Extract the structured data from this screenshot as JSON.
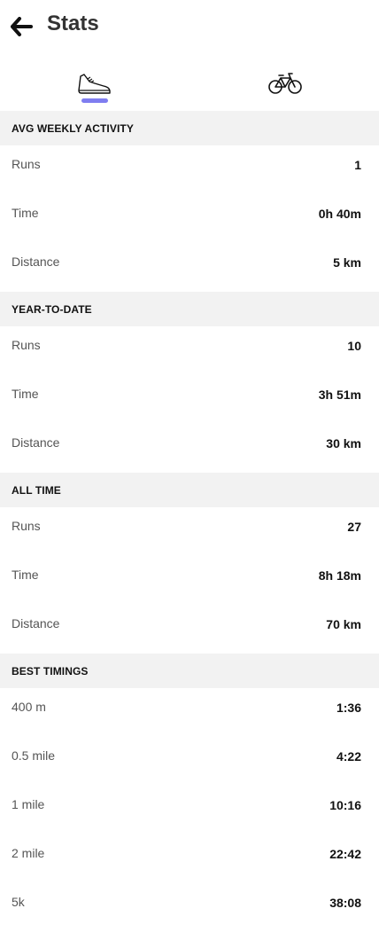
{
  "header": {
    "title": "Stats"
  },
  "tabs": [
    {
      "icon": "running-shoe-icon",
      "selected": true
    },
    {
      "icon": "bicycle-icon",
      "selected": false
    }
  ],
  "accent_color": "#7f7df0",
  "sections": [
    {
      "title": "AVG WEEKLY ACTIVITY",
      "rows": [
        {
          "label": "Runs",
          "value": "1"
        },
        {
          "label": "Time",
          "value": "0h 40m"
        },
        {
          "label": "Distance",
          "value": "5 km"
        }
      ]
    },
    {
      "title": "YEAR-TO-DATE",
      "rows": [
        {
          "label": "Runs",
          "value": "10"
        },
        {
          "label": "Time",
          "value": "3h 51m"
        },
        {
          "label": "Distance",
          "value": "30 km"
        }
      ]
    },
    {
      "title": "ALL TIME",
      "rows": [
        {
          "label": "Runs",
          "value": "27"
        },
        {
          "label": "Time",
          "value": "8h 18m"
        },
        {
          "label": "Distance",
          "value": "70 km"
        }
      ]
    },
    {
      "title": "BEST TIMINGS",
      "rows": [
        {
          "label": "400 m",
          "value": "1:36"
        },
        {
          "label": "0.5 mile",
          "value": "4:22"
        },
        {
          "label": "1 mile",
          "value": "10:16"
        },
        {
          "label": "2 mile",
          "value": "22:42"
        },
        {
          "label": "5k",
          "value": "38:08"
        }
      ]
    }
  ]
}
